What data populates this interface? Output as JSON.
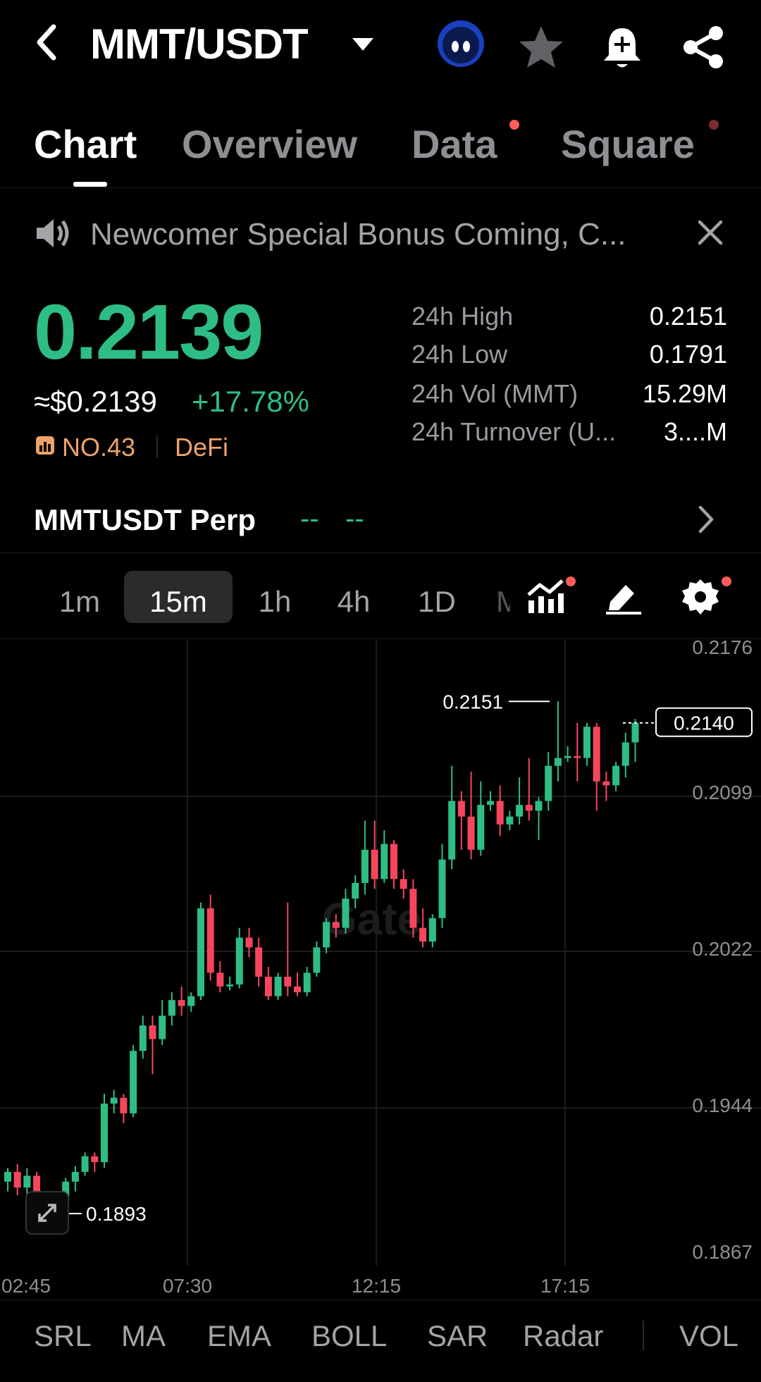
{
  "header": {
    "pair": "MMT/USDT",
    "icons": [
      "back-icon",
      "dropdown-icon",
      "token-logo",
      "star-icon",
      "bell-plus-icon",
      "share-icon"
    ]
  },
  "tabs": [
    {
      "label": "Chart",
      "active": true
    },
    {
      "label": "Overview",
      "active": false
    },
    {
      "label": "Data",
      "active": false,
      "dot": true
    },
    {
      "label": "Square",
      "active": false,
      "dot": true
    }
  ],
  "notice": {
    "text": "Newcomer Special Bonus Coming, C..."
  },
  "ticker": {
    "price": "0.2139",
    "usd": "≈$0.2139",
    "change": "+17.78%",
    "rank": "NO.43",
    "category": "DeFi",
    "stats": [
      {
        "label": "24h High",
        "value": "0.2151"
      },
      {
        "label": "24h Low",
        "value": "0.1791"
      },
      {
        "label": "24h Vol (MMT)",
        "value": "15.29M"
      },
      {
        "label": "24h Turnover (U...",
        "value": "3....M"
      }
    ]
  },
  "perp": {
    "label": "MMTUSDT Perp",
    "value1": "--",
    "value2": "--"
  },
  "timeframes": [
    "1m",
    "15m",
    "1h",
    "4h",
    "1D",
    "M"
  ],
  "active_timeframe": "15m",
  "chart_data": {
    "type": "candlestick",
    "y_ticks": [
      "0.2176",
      "0.2099",
      "0.2022",
      "0.1944",
      "0.1867"
    ],
    "x_ticks": [
      "02:45",
      "07:30",
      "12:15",
      "17:15"
    ],
    "ylim": [
      0.1867,
      0.2176
    ],
    "high_marker": "0.2151",
    "low_marker": "0.1893",
    "last_price_label": "0.2140",
    "watermark": "Gate",
    "candles": [
      [
        0.1905,
        0.191,
        0.19,
        0.1912
      ],
      [
        0.191,
        0.1902,
        0.1898,
        0.1914
      ],
      [
        0.1902,
        0.1908,
        0.1898,
        0.1912
      ],
      [
        0.1908,
        0.1895,
        0.189,
        0.191
      ],
      [
        0.1895,
        0.1888,
        0.188,
        0.19
      ],
      [
        0.1888,
        0.1895,
        0.1885,
        0.1898
      ],
      [
        0.1895,
        0.1905,
        0.1893,
        0.1907
      ],
      [
        0.1905,
        0.191,
        0.19,
        0.1913
      ],
      [
        0.191,
        0.1918,
        0.1908,
        0.192
      ],
      [
        0.1918,
        0.1915,
        0.191,
        0.192
      ],
      [
        0.1915,
        0.1945,
        0.1912,
        0.195
      ],
      [
        0.1945,
        0.1948,
        0.194,
        0.1952
      ],
      [
        0.1948,
        0.194,
        0.1935,
        0.195
      ],
      [
        0.194,
        0.1972,
        0.1938,
        0.1975
      ],
      [
        0.1972,
        0.1985,
        0.1968,
        0.199
      ],
      [
        0.1985,
        0.1978,
        0.196,
        0.199
      ],
      [
        0.1978,
        0.199,
        0.1975,
        0.1998
      ],
      [
        0.199,
        0.1998,
        0.1985,
        0.2002
      ],
      [
        0.1998,
        0.1995,
        0.199,
        0.2005
      ],
      [
        0.1995,
        0.2,
        0.1992,
        0.2002
      ],
      [
        0.2,
        0.2045,
        0.1998,
        0.2048
      ],
      [
        0.2045,
        0.2012,
        0.2008,
        0.2052
      ],
      [
        0.2012,
        0.2005,
        0.2002,
        0.2018
      ],
      [
        0.2005,
        0.2006,
        0.2003,
        0.201
      ],
      [
        0.2006,
        0.203,
        0.2004,
        0.2035
      ],
      [
        0.203,
        0.2025,
        0.202,
        0.2035
      ],
      [
        0.2025,
        0.201,
        0.2005,
        0.203
      ],
      [
        0.201,
        0.2,
        0.1998,
        0.2015
      ],
      [
        0.2,
        0.201,
        0.1998,
        0.2012
      ],
      [
        0.201,
        0.2005,
        0.2,
        0.2048
      ],
      [
        0.2005,
        0.2002,
        0.2,
        0.2012
      ],
      [
        0.2002,
        0.2012,
        0.2,
        0.2015
      ],
      [
        0.2012,
        0.2025,
        0.201,
        0.2028
      ],
      [
        0.2025,
        0.2038,
        0.2022,
        0.204
      ],
      [
        0.2038,
        0.2035,
        0.203,
        0.2042
      ],
      [
        0.2035,
        0.205,
        0.2032,
        0.2055
      ],
      [
        0.205,
        0.2058,
        0.2045,
        0.2062
      ],
      [
        0.2058,
        0.2075,
        0.2052,
        0.209
      ],
      [
        0.2075,
        0.206,
        0.2055,
        0.209
      ],
      [
        0.206,
        0.2078,
        0.2058,
        0.2085
      ],
      [
        0.2078,
        0.206,
        0.2055,
        0.208
      ],
      [
        0.206,
        0.2055,
        0.205,
        0.2065
      ],
      [
        0.2055,
        0.2035,
        0.203,
        0.206
      ],
      [
        0.2035,
        0.2028,
        0.2025,
        0.2045
      ],
      [
        0.2028,
        0.204,
        0.2025,
        0.2042
      ],
      [
        0.204,
        0.207,
        0.2035,
        0.2078
      ],
      [
        0.207,
        0.21,
        0.2065,
        0.2118
      ],
      [
        0.21,
        0.2092,
        0.2075,
        0.2105
      ],
      [
        0.2092,
        0.2075,
        0.207,
        0.2115
      ],
      [
        0.2075,
        0.2098,
        0.2072,
        0.211
      ],
      [
        0.2098,
        0.21,
        0.2095,
        0.2105
      ],
      [
        0.21,
        0.2088,
        0.2082,
        0.2108
      ],
      [
        0.2088,
        0.2092,
        0.2085,
        0.2095
      ],
      [
        0.2092,
        0.2098,
        0.2088,
        0.2112
      ],
      [
        0.2098,
        0.2095,
        0.209,
        0.2122
      ],
      [
        0.2095,
        0.21,
        0.208,
        0.2102
      ],
      [
        0.21,
        0.2118,
        0.2095,
        0.2125
      ],
      [
        0.2118,
        0.2122,
        0.211,
        0.2151
      ],
      [
        0.2122,
        0.2123,
        0.212,
        0.2128
      ],
      [
        0.2123,
        0.2122,
        0.211,
        0.214
      ],
      [
        0.2122,
        0.2138,
        0.2118,
        0.214
      ],
      [
        0.2138,
        0.211,
        0.2095,
        0.214
      ],
      [
        0.211,
        0.2108,
        0.21,
        0.2115
      ],
      [
        0.2108,
        0.2118,
        0.2105,
        0.212
      ],
      [
        0.2118,
        0.213,
        0.2112,
        0.2135
      ],
      [
        0.213,
        0.214,
        0.212,
        0.2142
      ]
    ]
  },
  "indicators": [
    "SRL",
    "MA",
    "EMA",
    "BOLL",
    "SAR",
    "Radar",
    "VOL"
  ]
}
